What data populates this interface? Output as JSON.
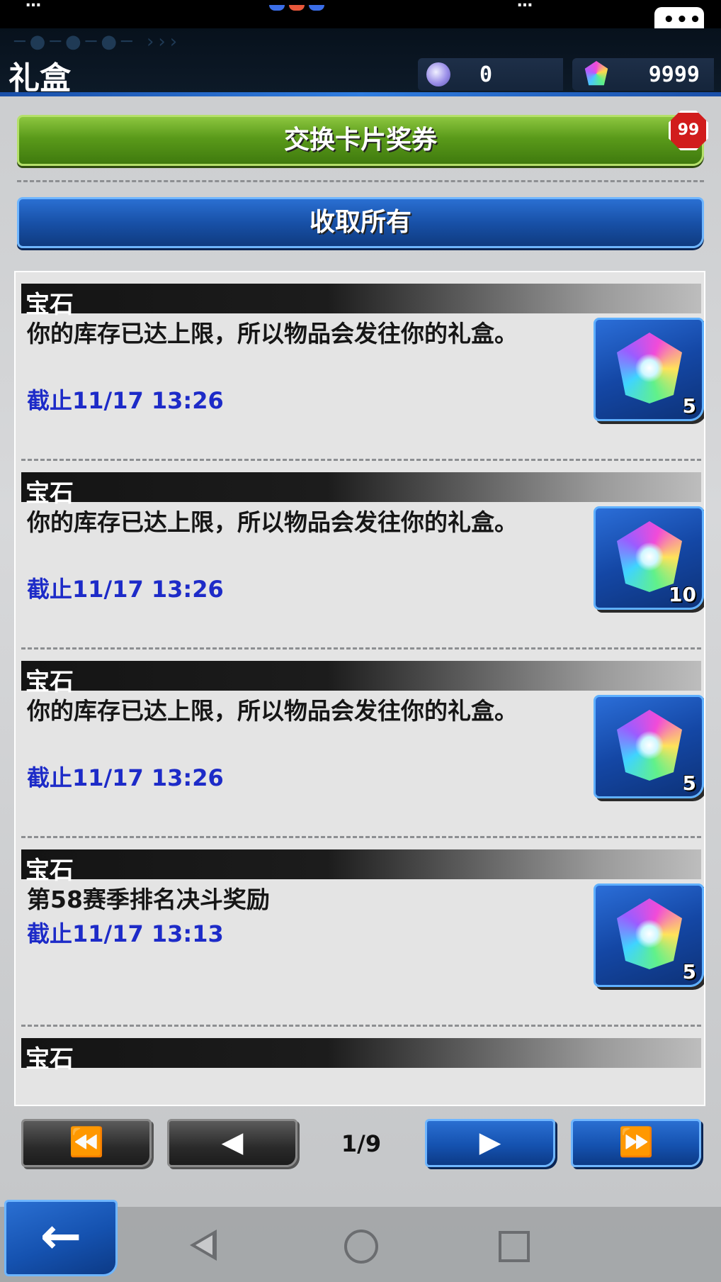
{
  "status": {
    "left_text": "…",
    "right_text": "…"
  },
  "header": {
    "title": "礼盒",
    "currency_orbs": {
      "value": "0",
      "icon": "orb-icon"
    },
    "currency_gems": {
      "value": "9999",
      "icon": "gem-icon"
    }
  },
  "actions": {
    "exchange_label": "交换卡片奖券",
    "exchange_badge": "99",
    "collect_all_label": "收取所有"
  },
  "items": [
    {
      "category": "宝石",
      "message": "你的库存已达上限，所以物品会发往你的礼盒。",
      "expiry": "截止11/17 13:26",
      "count": "5"
    },
    {
      "category": "宝石",
      "message": "你的库存已达上限，所以物品会发往你的礼盒。",
      "expiry": "截止11/17 13:26",
      "count": "10"
    },
    {
      "category": "宝石",
      "message": "你的库存已达上限，所以物品会发往你的礼盒。",
      "expiry": "截止11/17 13:26",
      "count": "5"
    },
    {
      "category": "宝石",
      "message": "第58赛季排名决斗奖励",
      "expiry": "截止11/17 13:13",
      "count": "5"
    },
    {
      "category": "宝石",
      "message": "",
      "expiry": "",
      "count": ""
    }
  ],
  "pager": {
    "first": "⏪",
    "prev": "◀",
    "next": "▶",
    "last": "⏩",
    "indicator": "1/9"
  },
  "back_button": "←",
  "colors": {
    "accent_blue": "#1851a8",
    "accent_green": "#5a9a1a",
    "expiry_text": "#1d2bc8",
    "badge_red": "#d11c1c"
  }
}
